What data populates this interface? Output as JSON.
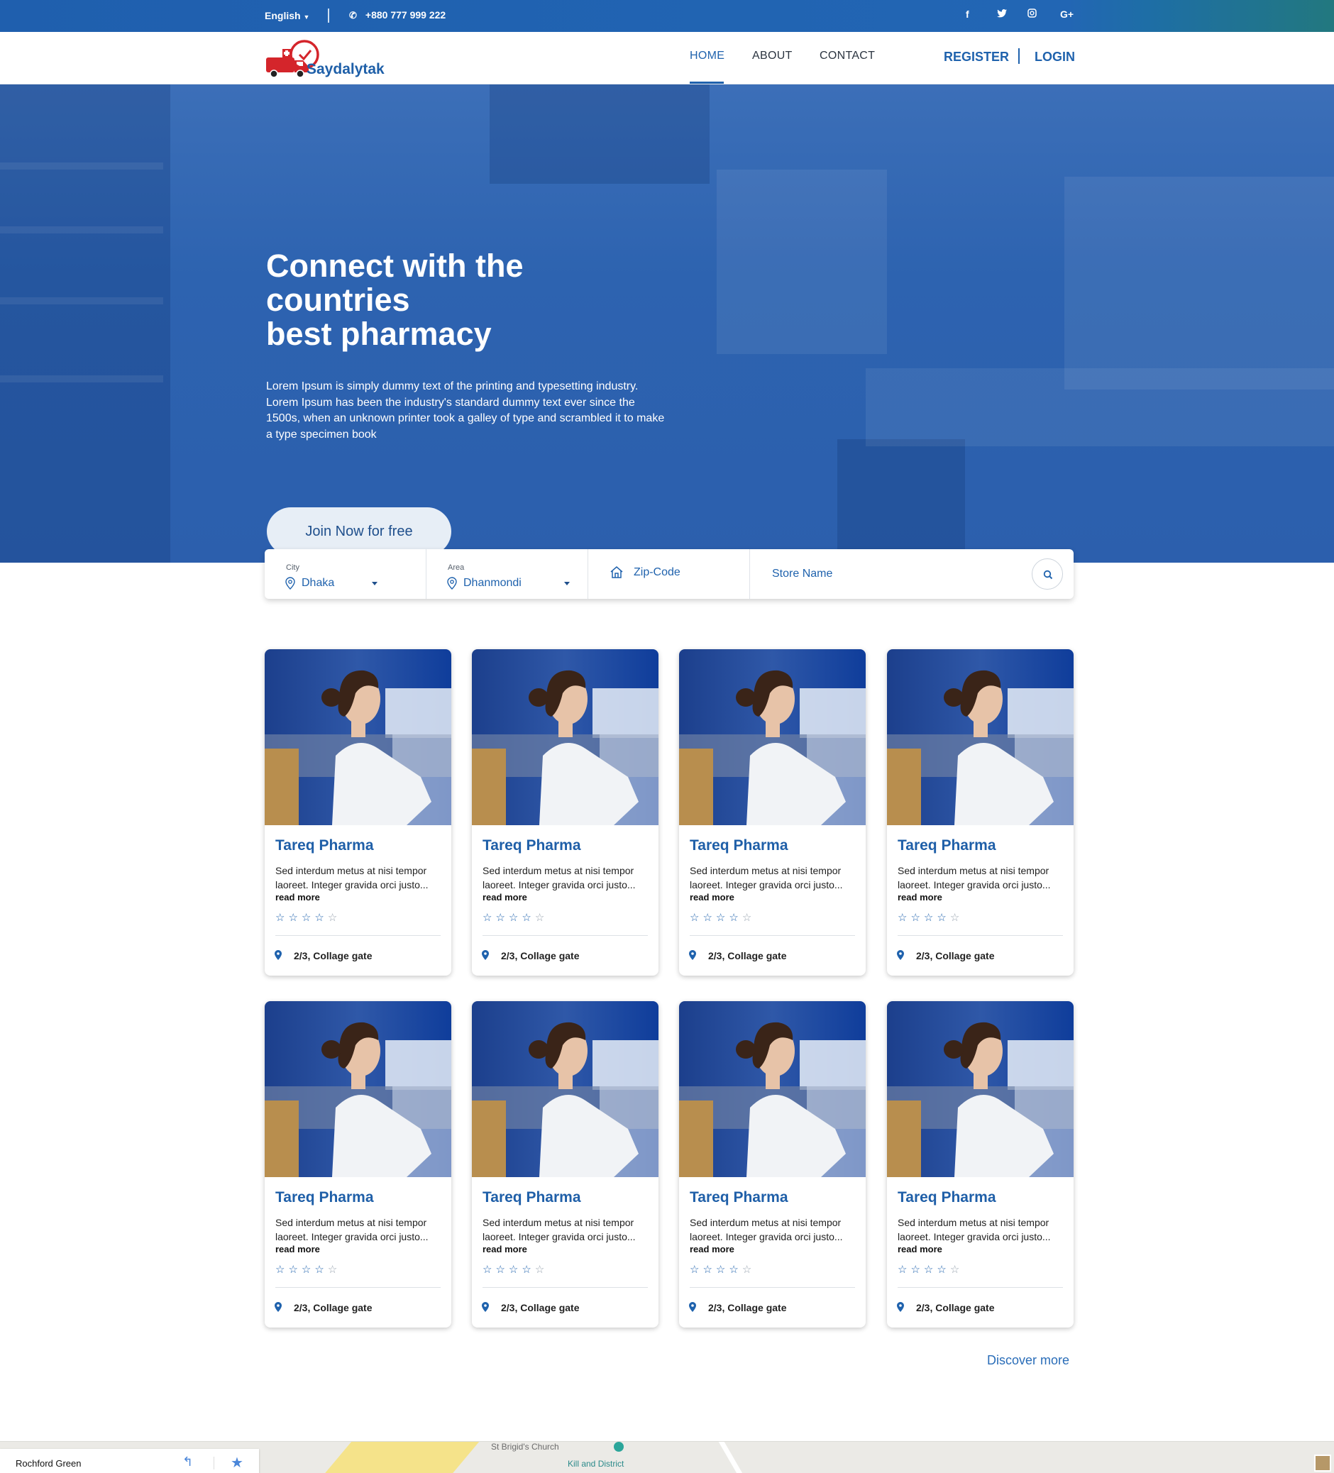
{
  "topbar": {
    "language": "English",
    "phone": "+880 777 999 222",
    "social": [
      "f",
      "t",
      "ig",
      "G+"
    ]
  },
  "brand": {
    "logo_text": "Saydalytak",
    "accent": "#1f62ad"
  },
  "nav": {
    "links": [
      "HOME",
      "ABOUT",
      "CONTACT"
    ],
    "register": "REGISTER",
    "login": "LOGIN"
  },
  "hero": {
    "title_line1": "Connect with the",
    "title_line2": "countries",
    "title_line3": "best pharmacy",
    "text": "Lorem Ipsum is simply dummy text of the printing and typesetting industry. Lorem Ipsum has been the industry's standard dummy text ever since the 1500s, when an unknown printer took a galley of type and scrambled it to make a type specimen book",
    "cta": "Join Now for free",
    "slide_count": 3,
    "active_slide": 3
  },
  "search": {
    "city_label": "City",
    "city_value": "Dhaka",
    "area_label": "Area",
    "area_value": "Dhanmondi",
    "zip_placeholder": "Zip-Code",
    "store_placeholder": "Store Name"
  },
  "cards": [
    {
      "title": "Tareq Pharma",
      "desc": "Sed interdum metus at nisi tempor laoreet. Integer gravida orci justo...",
      "more": "read more",
      "rating": 4,
      "location": "2/3, Collage gate"
    },
    {
      "title": "Tareq Pharma",
      "desc": "Sed interdum metus at nisi tempor laoreet. Integer gravida orci justo...",
      "more": "read more",
      "rating": 4,
      "location": "2/3, Collage gate"
    },
    {
      "title": "Tareq Pharma",
      "desc": "Sed interdum metus at nisi tempor laoreet. Integer gravida orci justo...",
      "more": "read more",
      "rating": 4,
      "location": "2/3, Collage gate"
    },
    {
      "title": "Tareq Pharma",
      "desc": "Sed interdum metus at nisi tempor laoreet. Integer gravida orci justo...",
      "more": "read more",
      "rating": 4,
      "location": "2/3, Collage gate"
    },
    {
      "title": "Tareq Pharma",
      "desc": "Sed interdum metus at nisi tempor laoreet. Integer gravida orci justo...",
      "more": "read more",
      "rating": 4,
      "location": "2/3, Collage gate"
    },
    {
      "title": "Tareq Pharma",
      "desc": "Sed interdum metus at nisi tempor laoreet. Integer gravida orci justo...",
      "more": "read more",
      "rating": 4,
      "location": "2/3, Collage gate"
    },
    {
      "title": "Tareq Pharma",
      "desc": "Sed interdum metus at nisi tempor laoreet. Integer gravida orci justo...",
      "more": "read more",
      "rating": 4,
      "location": "2/3, Collage gate"
    },
    {
      "title": "Tareq Pharma",
      "desc": "Sed interdum metus at nisi tempor laoreet. Integer gravida orci justo...",
      "more": "read more",
      "rating": 4,
      "location": "2/3, Collage gate"
    }
  ],
  "discover": "Discover more",
  "map": {
    "place": "Rochford Green",
    "labels": [
      "St Brigid's Church",
      "Kill and District"
    ]
  }
}
